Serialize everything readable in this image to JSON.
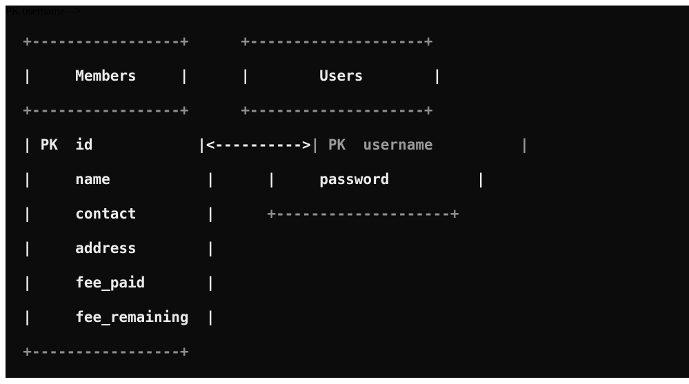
{
  "members_table": {
    "title": "Members",
    "pk_label": "PK",
    "fields": [
      "id",
      "name",
      "contact",
      "address",
      "fee_paid",
      "fee_remaining"
    ]
  },
  "users_table": {
    "title": "Users",
    "pk_label": "PK",
    "fields": [
      "username",
      "password"
    ]
  },
  "relation": {
    "arrow": "<---------->"
  },
  "border_top_members": "+-----------------+",
  "border_top_users": "+--------------------+"
}
